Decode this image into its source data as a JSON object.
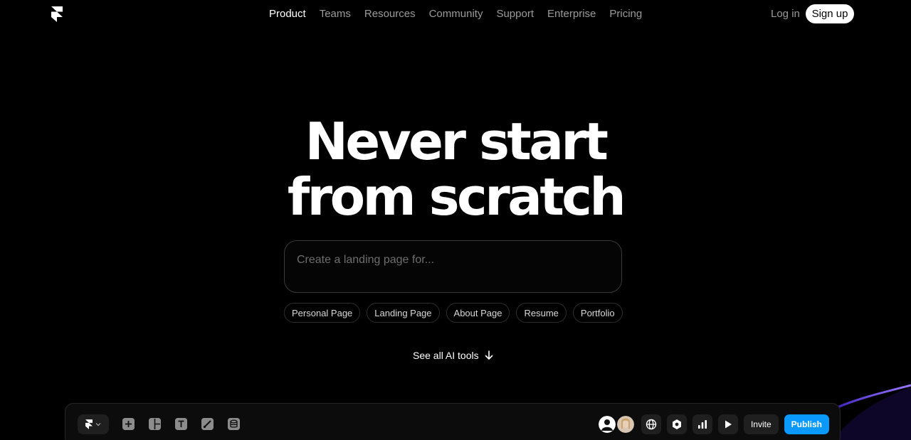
{
  "nav": {
    "links": [
      "Product",
      "Teams",
      "Resources",
      "Community",
      "Support",
      "Enterprise",
      "Pricing"
    ],
    "login_label": "Log in",
    "signup_label": "Sign up"
  },
  "hero": {
    "headline_line1": "Never start",
    "headline_line2": "from scratch",
    "prompt_placeholder": "Create a landing page for...",
    "chips": [
      "Personal Page",
      "Landing Page",
      "About Page",
      "Resume",
      "Portfolio"
    ],
    "see_all_label": "See all AI tools"
  },
  "editor": {
    "tool_icons": [
      "insert-icon",
      "layout-icon",
      "text-icon",
      "vector-icon",
      "cms-icon"
    ],
    "invite_label": "Invite",
    "publish_label": "Publish",
    "accent_color": "#0a99ff"
  },
  "colors": {
    "background": "#000000",
    "nav_inactive": "#9a9a9a",
    "glow": "#7b4dff"
  }
}
